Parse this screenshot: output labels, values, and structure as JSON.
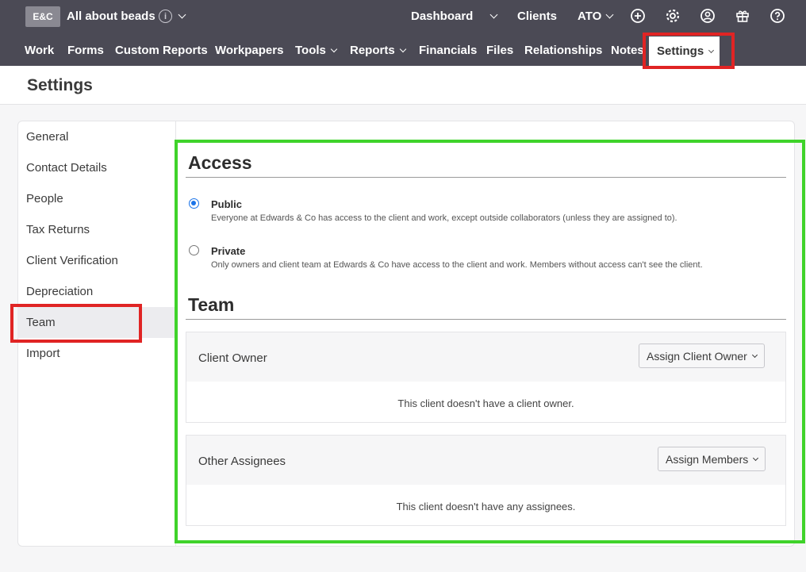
{
  "topbar": {
    "logo": "E&C",
    "client_name": "All about beads",
    "info_icon": "i",
    "links": {
      "dashboard": "Dashboard",
      "clients": "Clients",
      "ato": "ATO"
    },
    "icons": [
      "plus-circle-icon",
      "gear-icon",
      "user-circle-icon",
      "gift-icon",
      "help-icon"
    ]
  },
  "nav": {
    "items": [
      "Work",
      "Forms",
      "Custom Reports",
      "Workpapers",
      "Tools",
      "Reports",
      "Financials",
      "Files",
      "Relationships",
      "Notes",
      "Settings"
    ],
    "active": "Settings"
  },
  "page": {
    "title": "Settings"
  },
  "sidebar": {
    "items": [
      "General",
      "Contact Details",
      "People",
      "Tax Returns",
      "Client Verification",
      "Depreciation",
      "Team",
      "Import"
    ],
    "active": "Team"
  },
  "access": {
    "title": "Access",
    "options": [
      {
        "label": "Public",
        "desc": "Everyone at Edwards & Co has access to the client and work, except outside collaborators (unless they are assigned to).",
        "checked": true
      },
      {
        "label": "Private",
        "desc": "Only owners and client team at Edwards & Co have access to the client and work. Members without access can't see the client.",
        "checked": false
      }
    ]
  },
  "team": {
    "title": "Team",
    "client_owner": {
      "label": "Client Owner",
      "button": "Assign Client Owner",
      "empty": "This client doesn't have a client owner."
    },
    "other_assignees": {
      "label": "Other Assignees",
      "button": "Assign Members",
      "empty": "This client doesn't have any assignees."
    }
  },
  "colors": {
    "topbar": "#4b4a55",
    "highlight_red": "#e02424",
    "highlight_green": "#3fd32a",
    "radio_accent": "#1a73e8"
  }
}
